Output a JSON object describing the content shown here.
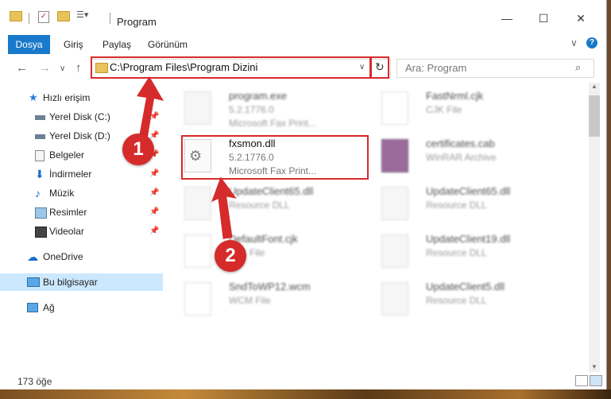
{
  "window": {
    "title": "Program",
    "controls": {
      "minimize": "—",
      "maximize": "☐",
      "close": "✕"
    }
  },
  "ribbon": {
    "tabs": [
      "Dosya",
      "Giriş",
      "Paylaş",
      "Görünüm"
    ],
    "help": "?"
  },
  "navbar": {
    "back": "←",
    "forward": "→",
    "dropdown": "∨",
    "up": "↑",
    "path": "C:\\Program Files\\Program Dizini",
    "path_dropdown": "∨",
    "refresh": "↻",
    "search_placeholder": "Ara: Program"
  },
  "sidebar": {
    "items": [
      {
        "label": "Hızlı erişim",
        "icon": "star-icon",
        "pinned": false
      },
      {
        "label": "Yerel Disk (C:)",
        "icon": "drive-icon",
        "pinned": true
      },
      {
        "label": "Yerel Disk (D:)",
        "icon": "drive-icon",
        "pinned": true
      },
      {
        "label": "Belgeler",
        "icon": "documents-icon",
        "pinned": true
      },
      {
        "label": "İndirmeler",
        "icon": "download-icon",
        "pinned": true
      },
      {
        "label": "Müzik",
        "icon": "music-icon",
        "pinned": true
      },
      {
        "label": "Resimler",
        "icon": "pictures-icon",
        "pinned": true
      },
      {
        "label": "Videolar",
        "icon": "video-icon",
        "pinned": true
      },
      {
        "label": "OneDrive",
        "icon": "cloud-icon",
        "pinned": false
      },
      {
        "label": "Bu bilgisayar",
        "icon": "computer-icon",
        "pinned": false,
        "selected": true
      },
      {
        "label": "Ağ",
        "icon": "network-icon",
        "pinned": false
      }
    ]
  },
  "files": [
    {
      "name": "program.exe",
      "line2": "5.2.1776.0",
      "line3": "Microsoft Fax Print..."
    },
    {
      "name": "FastNrml.cjk",
      "line2": "CJK File",
      "line3": ""
    },
    {
      "name": "fxsmon.dll",
      "line2": "5.2.1776.0",
      "line3": "Microsoft Fax Print...",
      "highlighted": true
    },
    {
      "name": "certificates.cab",
      "line2": "WinRAR Archive",
      "line3": ""
    },
    {
      "name": "UpdateClient65.dll",
      "line2": "Resource DLL",
      "line3": ""
    },
    {
      "name": "UpdateClient65.dll",
      "line2": "Resource DLL",
      "line3": ""
    },
    {
      "name": "DefaultFont.cjk",
      "line2": "CJK File",
      "line3": ""
    },
    {
      "name": "UpdateClient19.dll",
      "line2": "Resource DLL",
      "line3": ""
    },
    {
      "name": "SndToWP12.wcm",
      "line2": "WCM File",
      "line3": ""
    },
    {
      "name": "UpdateClient5.dll",
      "line2": "Resource DLL",
      "line3": ""
    }
  ],
  "status": {
    "count": "173 öğe"
  },
  "annotations": {
    "step1": "1",
    "step2": "2",
    "color": "#d62b2b"
  }
}
